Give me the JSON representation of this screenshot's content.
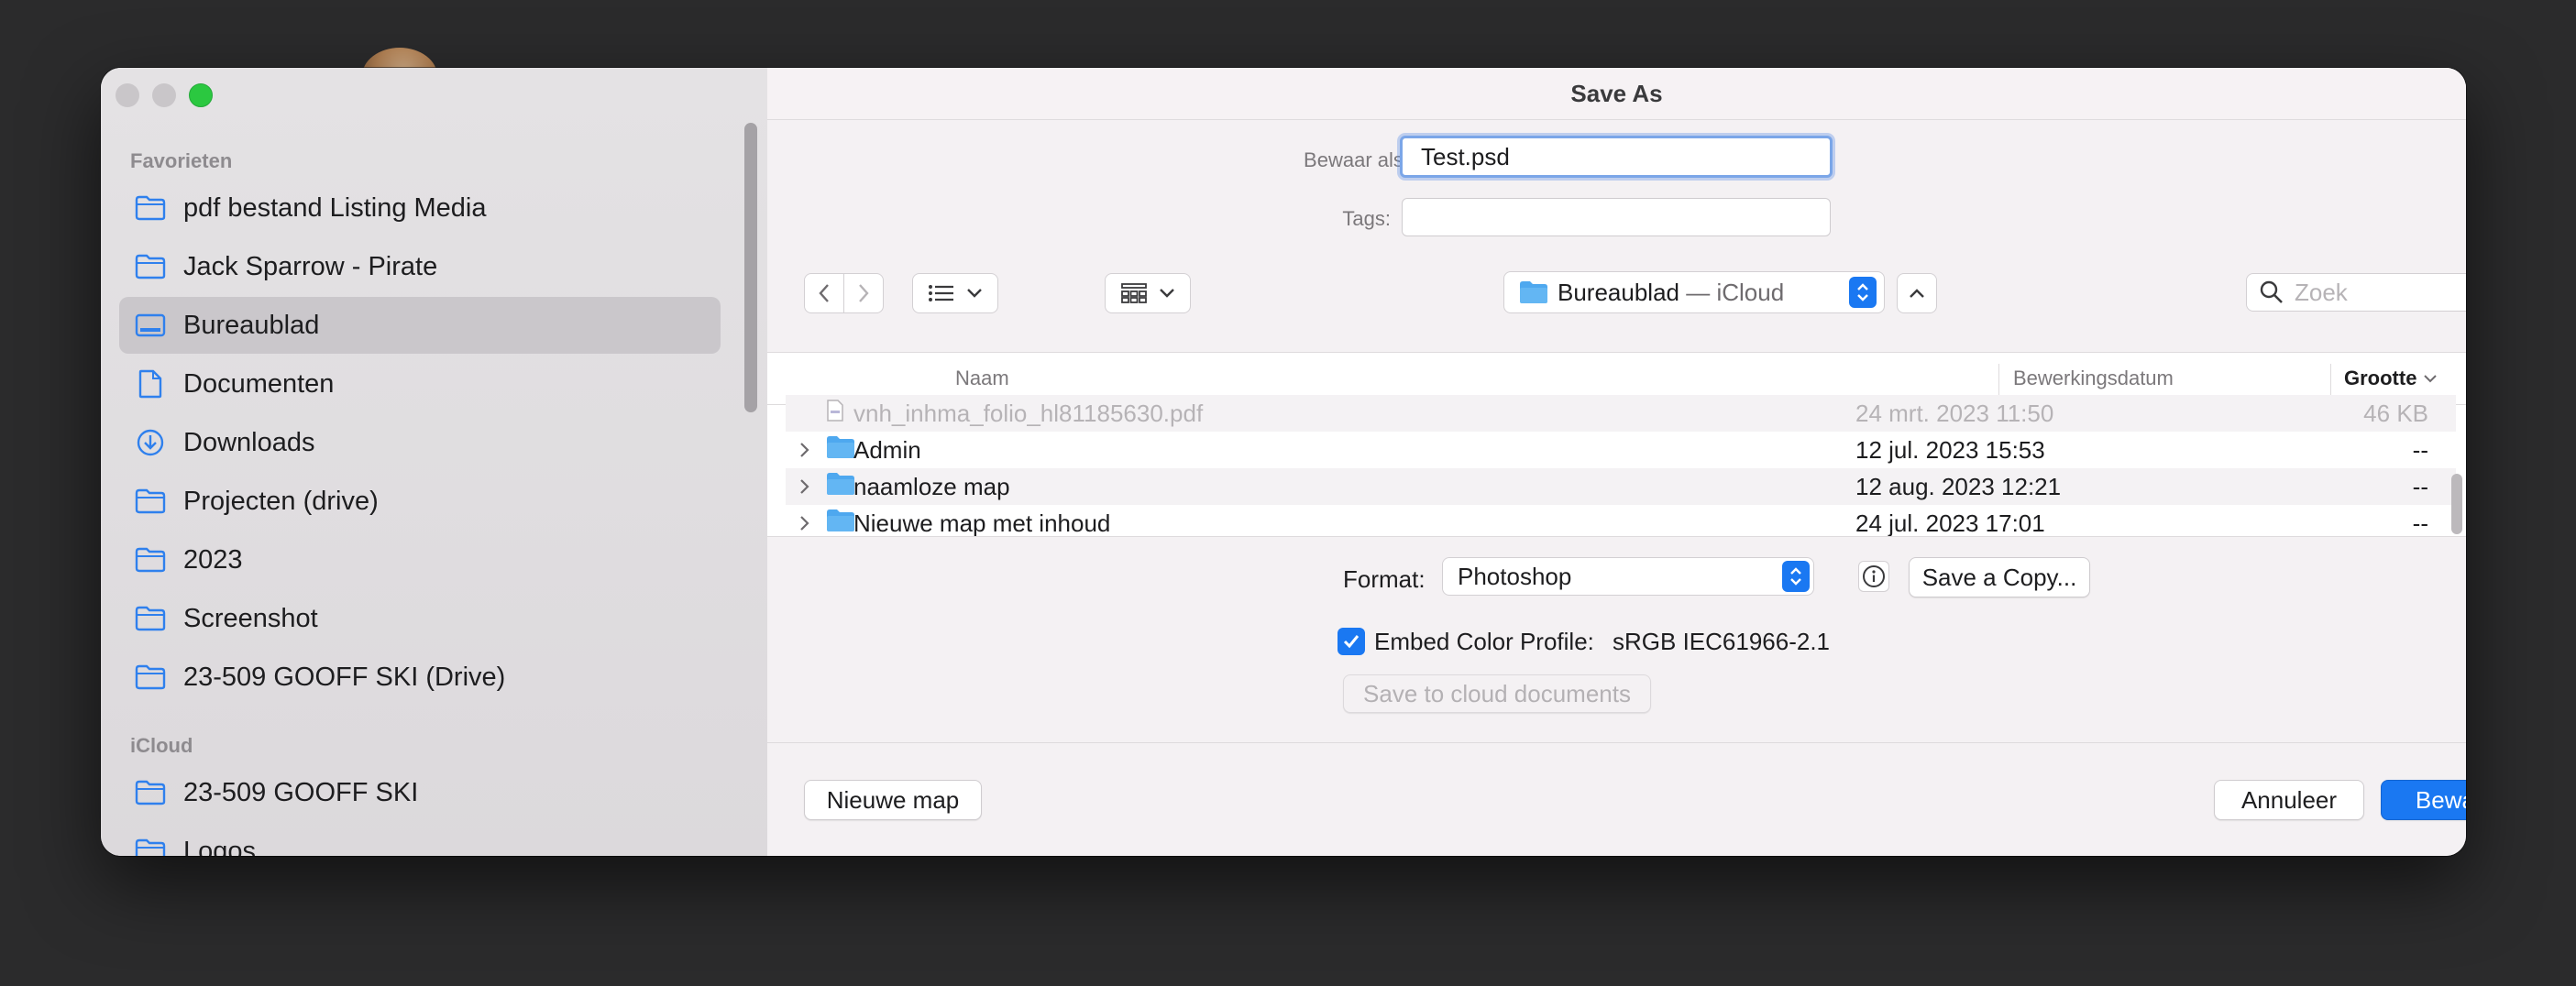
{
  "dialog": {
    "title": "Save As"
  },
  "sidebar": {
    "sections": [
      {
        "title": "Favorieten",
        "items": [
          {
            "label": "pdf bestand Listing Media",
            "icon": "folder-icon"
          },
          {
            "label": "Jack Sparrow - Pirate",
            "icon": "folder-icon"
          },
          {
            "label": "Bureaublad",
            "icon": "desktop-icon",
            "selected": true
          },
          {
            "label": "Documenten",
            "icon": "document-icon"
          },
          {
            "label": "Downloads",
            "icon": "download-icon"
          },
          {
            "label": "Projecten (drive)",
            "icon": "folder-icon"
          },
          {
            "label": "2023",
            "icon": "folder-icon"
          },
          {
            "label": "Screenshot",
            "icon": "folder-icon"
          },
          {
            "label": "23-509 GOOFF SKI (Drive)",
            "icon": "folder-icon"
          }
        ]
      },
      {
        "title": "iCloud",
        "items": [
          {
            "label": "23-509 GOOFF SKI",
            "icon": "folder-icon"
          },
          {
            "label": "Logos",
            "icon": "folder-icon"
          }
        ]
      }
    ]
  },
  "form": {
    "save_as_label": "Bewaar als:",
    "save_as_value": "Test.psd",
    "tags_label": "Tags:",
    "tags_value": ""
  },
  "toolbar": {
    "back_icon": "chevron-left-icon",
    "forward_icon": "chevron-right-icon",
    "list_view_icon": "list-view-icon",
    "grid_view_icon": "grid-view-icon",
    "location": {
      "name": "Bureaublad",
      "suffix": " — iCloud"
    },
    "search_placeholder": "Zoek"
  },
  "file_list": {
    "columns": {
      "name": "Naam",
      "date": "Bewerkingsdatum",
      "size": "Grootte"
    },
    "rows": [
      {
        "name": "vnh_inhma_folio_hl81185630.pdf",
        "date": "24 mrt. 2023 11:50",
        "size": "46 KB",
        "type": "file",
        "faded": true
      },
      {
        "name": "Admin",
        "date": "12 jul. 2023 15:53",
        "size": "--",
        "type": "folder"
      },
      {
        "name": "naamloze map",
        "date": "12 aug. 2023 12:21",
        "size": "--",
        "type": "folder"
      },
      {
        "name": "Nieuwe map met inhoud",
        "date": "24 jul. 2023 17:01",
        "size": "--",
        "type": "folder"
      }
    ]
  },
  "options": {
    "format_label": "Format:",
    "format_value": "Photoshop",
    "save_copy_label": "Save a Copy...",
    "embed_label": "Embed Color Profile:",
    "embed_value": "sRGB IEC61966-2.1",
    "embed_checked": true,
    "cloud_label": "Save to cloud documents"
  },
  "footer": {
    "new_folder_label": "Nieuwe map",
    "cancel_label": "Annuleer",
    "save_label": "Bewaar"
  },
  "colors": {
    "accent": "#1a78f2",
    "icon_blue": "#2f80ed",
    "selected_sidebar": "#cac7cb"
  }
}
